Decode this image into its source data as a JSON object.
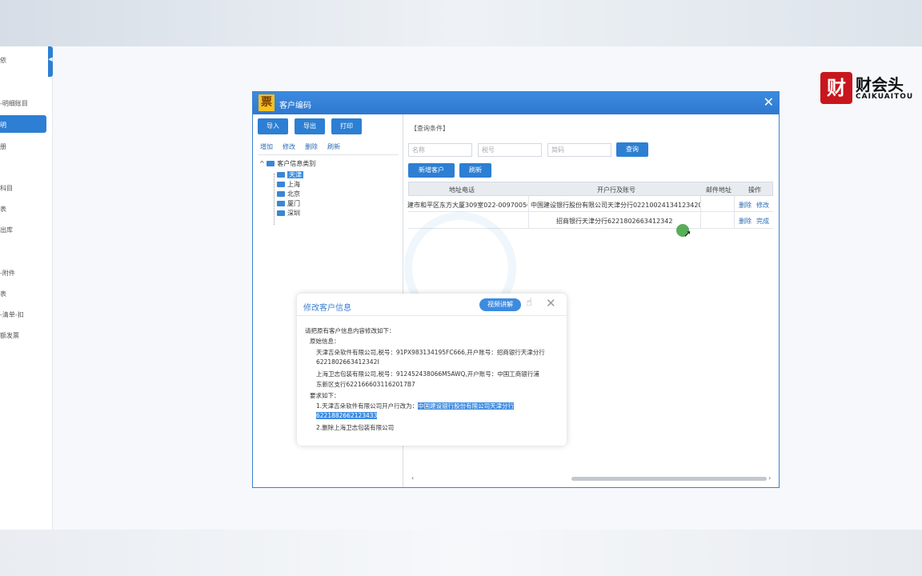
{
  "sidebar": {
    "items": [
      "依",
      "-明细账目",
      "册",
      "科目",
      "表",
      "出库",
      "-附件",
      "表",
      "-清单-扣",
      "额发票"
    ],
    "active": "明"
  },
  "brand": {
    "mark": "财",
    "name": "财会头",
    "sub": "CAIKUAITOU"
  },
  "dialog": {
    "title": "客户编码",
    "logo": "票",
    "close": "✕",
    "buttons": {
      "import": "导入",
      "export": "导出",
      "print": "打印"
    },
    "actions": {
      "add": "增加",
      "modify": "修改",
      "delete": "删除",
      "refresh": "刷新"
    },
    "tree": {
      "root": "客户信息类别",
      "nodes": [
        "天津",
        "上海",
        "北京",
        "厦门",
        "深圳"
      ]
    },
    "query": {
      "label": "【查询条件】",
      "name_placeholder": "名称",
      "tax_placeholder": "税号",
      "code_placeholder": "简码",
      "search_button": "查询",
      "new_customer": "新增客户",
      "refresh": "刷新"
    },
    "table": {
      "headers": [
        "地址电话",
        "开户行及账号",
        "邮件地址",
        "操作"
      ],
      "rows": [
        {
          "address": "建市和平区东方大厦309室022-00970050",
          "bank": "中国建设银行股份有限公司天津分行02210024134123420",
          "email": "",
          "ops": [
            "删除",
            "修改"
          ]
        },
        {
          "address": "",
          "bank": "招商银行天津分行6221802663412342",
          "email": "",
          "ops": [
            "删除",
            "完成"
          ]
        }
      ]
    },
    "scroll": {
      "left": "‹",
      "right": "›"
    }
  },
  "popup": {
    "title": "修改客户信息",
    "action_button": "视频讲解",
    "close": "✕",
    "lines": [
      "请把原有客户信息内容修改如下：",
      "原始信息：",
      "天津吉朵软件有限公司,税号：91PX983134195FC666,开户账号：招商银行天津分行",
      "6221802663412342I",
      "上海卫志包装有限公司,税号：912452438066M5AWQ,开户账号：中国工商银行浦",
      "东新区支行6221666031162017B7",
      "要求如下：",
      "1.天津吉朵软件有限公司开户行改为："
    ],
    "highlight_1": "中国建设银行股份有限公司天津分行",
    "highlight_2": "6221882662123433",
    "last_line": "2.删除上海卫志包装有限公司"
  }
}
